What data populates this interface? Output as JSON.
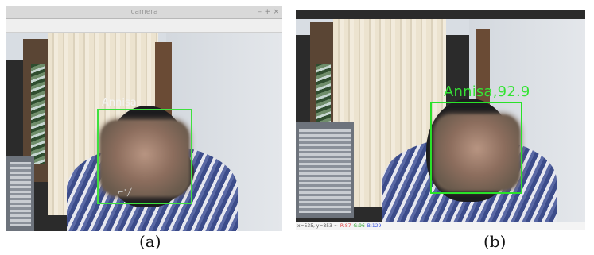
{
  "panel_a": {
    "window_title": "camera",
    "window_controls": [
      "–",
      "+",
      "×"
    ],
    "face_label": "Annisa",
    "caption": "(a)"
  },
  "panel_b": {
    "face_label": "Annisa,92.9",
    "status": {
      "coords": "x=535, y=853 ~",
      "r": "R:87",
      "g": "G:96",
      "b": "B:129"
    },
    "caption": "(b)"
  },
  "colors": {
    "detection_box": "#3fe03f",
    "label_b": "#35e435"
  }
}
